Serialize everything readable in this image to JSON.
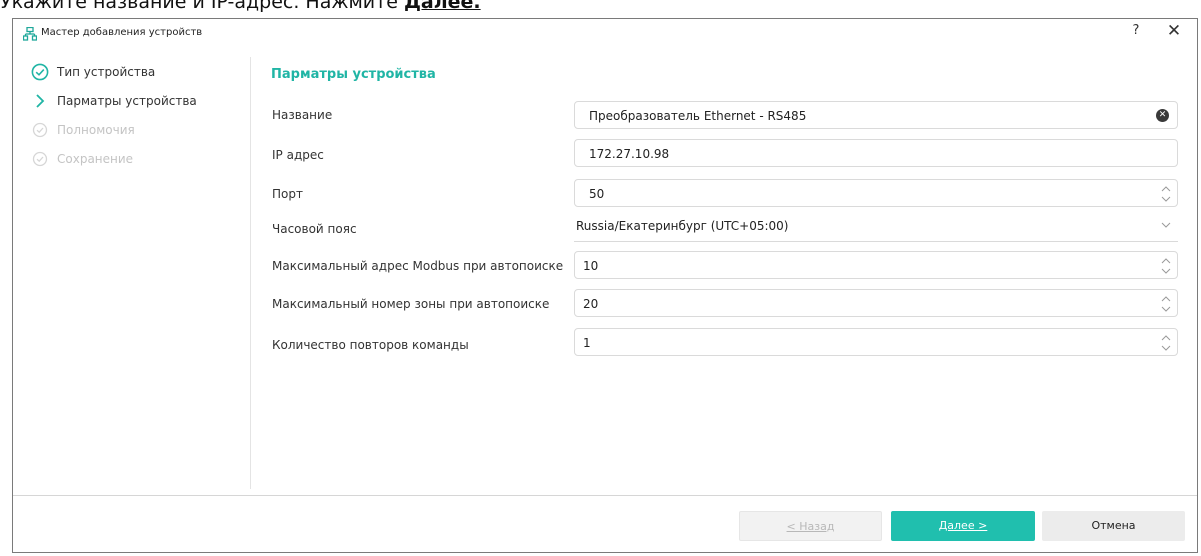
{
  "caption": {
    "text": "Укажите название и IP-адрес. Нажмите",
    "bold": "Далее."
  },
  "window": {
    "title": "Мастер добавления устройств",
    "help": "?",
    "close": "✕"
  },
  "steps": [
    {
      "label": "Тип устройства",
      "state": "done"
    },
    {
      "label": "Парматры устройства",
      "state": "active"
    },
    {
      "label": "Полномочия",
      "state": "disabled"
    },
    {
      "label": "Сохранение",
      "state": "disabled"
    }
  ],
  "section_title": "Парматры устройства",
  "fields": {
    "name": {
      "label": "Название",
      "value": "Преобразователь Ethernet - RS485"
    },
    "ip": {
      "label": "IP адрес",
      "value": "172.27.10.98"
    },
    "port": {
      "label": "Порт",
      "value": "50"
    },
    "timezone": {
      "label": "Часовой пояс",
      "value": "Russia/Екатеринбург (UTC+05:00)"
    },
    "max_modbus": {
      "label": "Максимальный адрес Modbus при автопоиске",
      "value": "10"
    },
    "max_zone": {
      "label": "Максимальный номер зоны при автопоиске",
      "value": "20"
    },
    "retries": {
      "label": "Количество повторов команды",
      "value": "1"
    }
  },
  "buttons": {
    "back": "< Назад",
    "next": "Далее >",
    "cancel": "Отмена"
  },
  "colors": {
    "accent": "#20b5a5",
    "primary_button": "#20bfae",
    "disabled_text": "#c4c4c4"
  },
  "icons": {
    "title": "network-icon",
    "done": "check-circle-icon",
    "active": "chevron-right-icon",
    "pending": "check-circle-outline-icon",
    "clear": "clear-icon",
    "spinner": "spinner-icon",
    "dropdown": "chevron-down-icon"
  }
}
